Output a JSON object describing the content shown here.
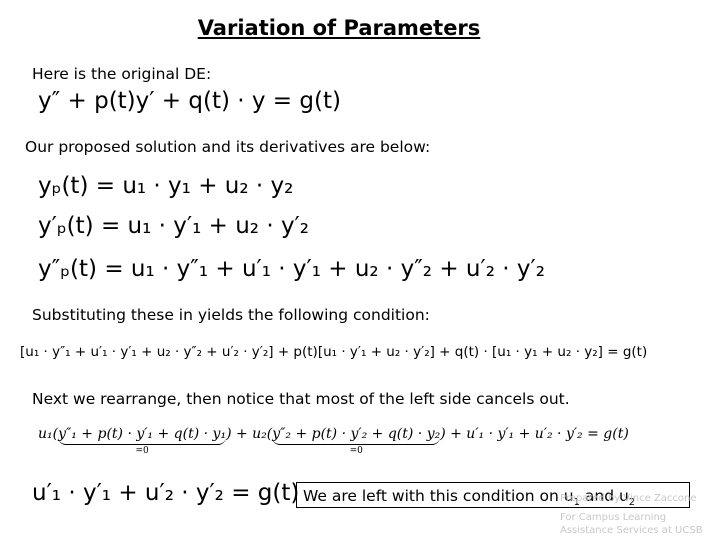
{
  "title": "Variation of Parameters",
  "intro_text": "Here is the original DE:",
  "original_de": "y″ + p(t)y′ + q(t) · y = g(t)",
  "proposed_text": "Our proposed solution and its derivatives are below:",
  "solution_equations": [
    "yₚ(t) = u₁ · y₁ + u₂ · y₂",
    "y′ₚ(t) = u₁ · y′₁ + u₂ · y′₂",
    "y″ₚ(t) = u₁ · y″₁ + u′₁ · y′₁ + u₂ · y″₂ + u′₂ · y′₂"
  ],
  "substituting_text": "Substituting these in yields the following condition:",
  "substituted_equation": "[u₁ · y″₁ + u′₁ · y′₁ + u₂ · y″₂ + u′₂ · y′₂] + p(t)[u₁ · y′₁ + u₂ · y′₂] + q(t) · [u₁ · y₁ + u₂ · y₂] = g(t)",
  "rearrange_text": "Next we rearrange, then notice that most of the left side cancels out.",
  "rearranged": {
    "part1_prefix": "u₁(",
    "part1_group": "y″₁ + p(t) · y′₁ + q(t) · y₁",
    "part2_prefix": ") + u₂(",
    "part2_group": "y″₂ + p(t) · y′₂ + q(t) · y₂",
    "suffix": ") + u′₁ · y′₁ + u′₂ · y′₂ = g(t)",
    "zero_label": "=0"
  },
  "final_condition": "u′₁ · y′₁ + u′₂ · y′₂ = g(t)",
  "callout": {
    "text": "We are left with this condition on u",
    "sub1": "1",
    "and": " and u",
    "sub2": "2"
  },
  "footer": [
    "Prepared by Vince Zaccone",
    "For Campus Learning",
    "Assistance Services at UCSB"
  ]
}
